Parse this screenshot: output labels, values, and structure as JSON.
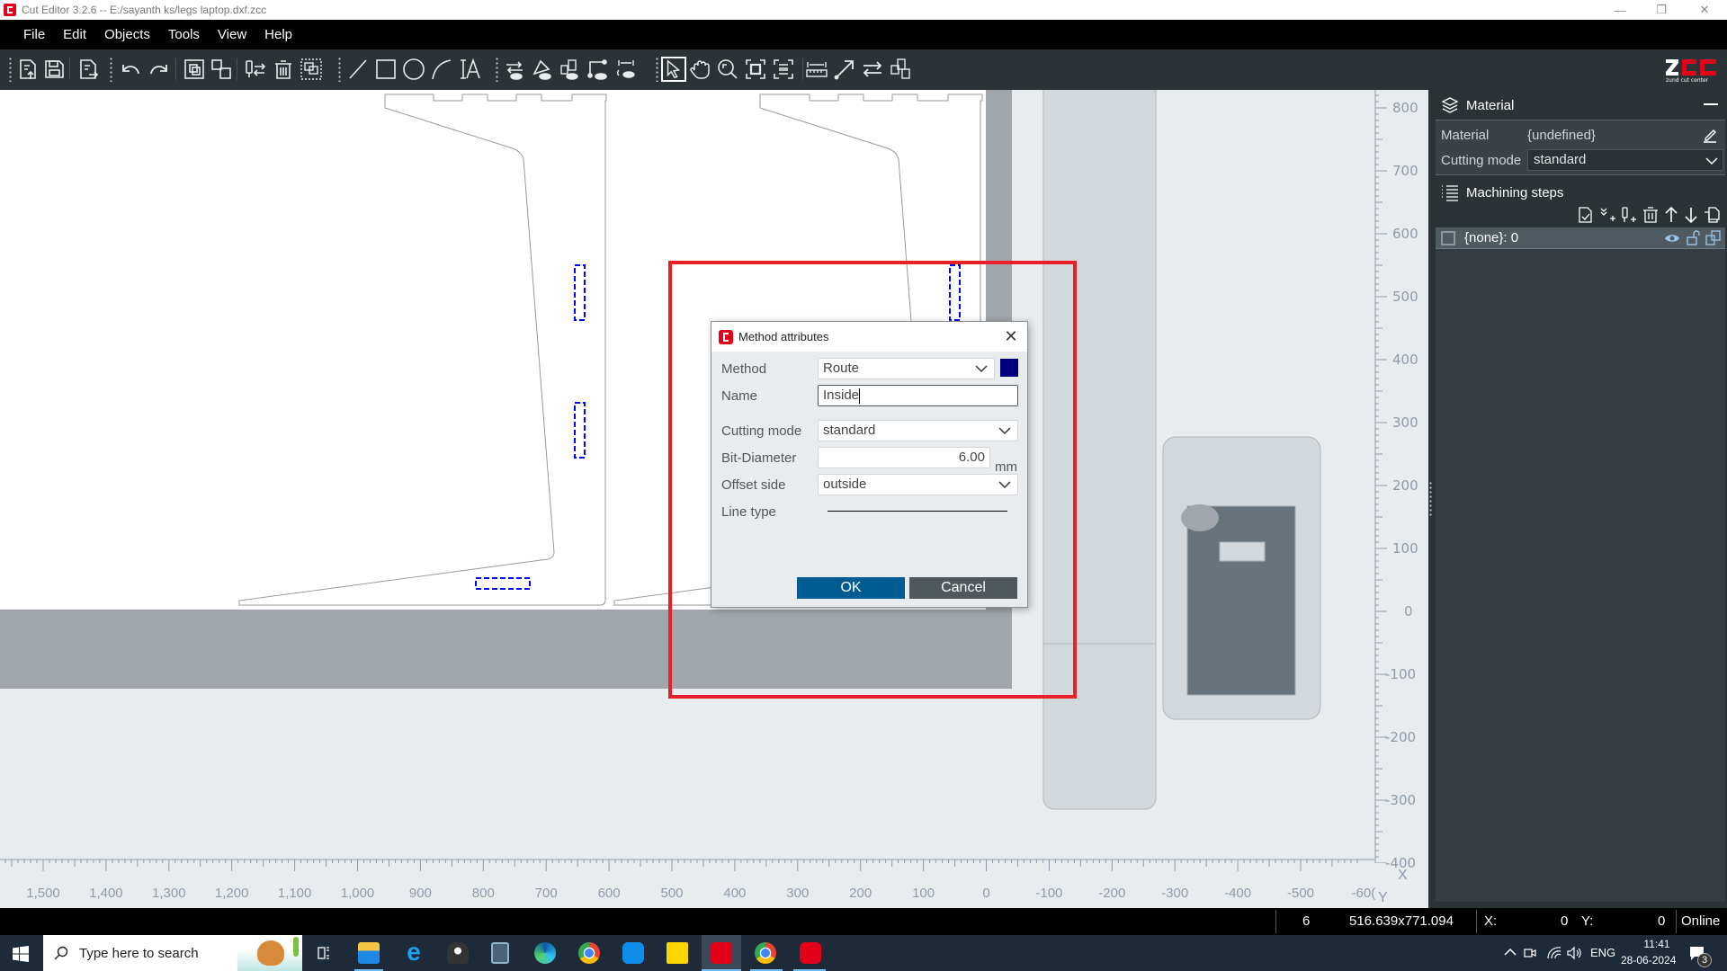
{
  "window": {
    "title": "Cut Editor 3.2.6   --   E:/sayanth ks/legs laptop.dxf.zcc",
    "controls": {
      "minimize": "—",
      "restore": "❐",
      "close": "✕"
    }
  },
  "menu": [
    "File",
    "Edit",
    "Objects",
    "Tools",
    "View",
    "Help"
  ],
  "toolbar": {
    "tools": [
      "open-file",
      "save",
      "export",
      "undo",
      "redo",
      "group",
      "ungroup",
      "swap-tool",
      "delete",
      "select-overlapping",
      "line",
      "rectangle",
      "circle",
      "arc",
      "text",
      "direction-view",
      "nodes-view",
      "order-view",
      "start-point-view",
      "spacing-view",
      "select",
      "pan",
      "zoom",
      "zoom-fit",
      "zoom-page",
      "measure",
      "move-to",
      "reverse-direction",
      "reorder"
    ],
    "active_tool": "select",
    "logo": {
      "text": "ZCC",
      "subtitle": "zund cut center",
      "color": "#e2001a"
    }
  },
  "canvas": {
    "x_axis_label": "X",
    "y_axis_label": "Y",
    "x_ticks": [
      "1,500",
      "1,400",
      "1,300",
      "1,200",
      "1,100",
      "1,000",
      "900",
      "800",
      "700",
      "600",
      "500",
      "400",
      "300",
      "200",
      "100",
      "0",
      "-100",
      "-200",
      "-300",
      "-400",
      "-500",
      "-60("
    ],
    "y_ticks": [
      "800",
      "700",
      "600",
      "500",
      "400",
      "300",
      "200",
      "100",
      "0",
      "-100",
      "-200",
      "-300",
      "-400"
    ],
    "selection_color": "#0000ff",
    "highlight_color": "#e8202a"
  },
  "right_panel": {
    "material_section": {
      "title": "Material",
      "material_label": "Material",
      "material_value": "{undefined}",
      "cutting_mode_label": "Cutting mode",
      "cutting_mode_value": "standard"
    },
    "machining_steps": {
      "title": "Machining steps",
      "actions": [
        "new-step",
        "add-method",
        "add-tool",
        "delete-step",
        "move-up",
        "move-down",
        "copy-step"
      ],
      "items": [
        {
          "label": "{none}: 0",
          "checked": false
        }
      ]
    }
  },
  "dialog": {
    "title": "Method attributes",
    "method_label": "Method",
    "method_value": "Route",
    "method_color": "#000080",
    "name_label": "Name",
    "name_value": "Inside",
    "cutting_mode_label": "Cutting mode",
    "cutting_mode_value": "standard",
    "bit_diameter_label": "Bit-Diameter",
    "bit_diameter_value": "6.00",
    "bit_diameter_unit": "mm",
    "offset_side_label": "Offset side",
    "offset_side_value": "outside",
    "line_type_label": "Line type",
    "ok_label": "OK",
    "cancel_label": "Cancel"
  },
  "statusbar": {
    "count": "6",
    "dimensions": "516.639x771.094",
    "x_label": "X:",
    "x_value": "0",
    "y_label": "Y:",
    "y_value": "0",
    "connection": "Online"
  },
  "taskbar": {
    "search_placeholder": "Type here to search",
    "apps": [
      "task-view",
      "file-explorer",
      "internet-explorer",
      "inkscape",
      "calculator",
      "edge",
      "chrome",
      "teamviewer",
      "sticky-notes",
      "cut-editor",
      "chrome-profile",
      "zcc-app"
    ],
    "tray": {
      "language": "ENG",
      "time": "11:41",
      "date": "28-06-2024",
      "notifications": "3"
    }
  }
}
